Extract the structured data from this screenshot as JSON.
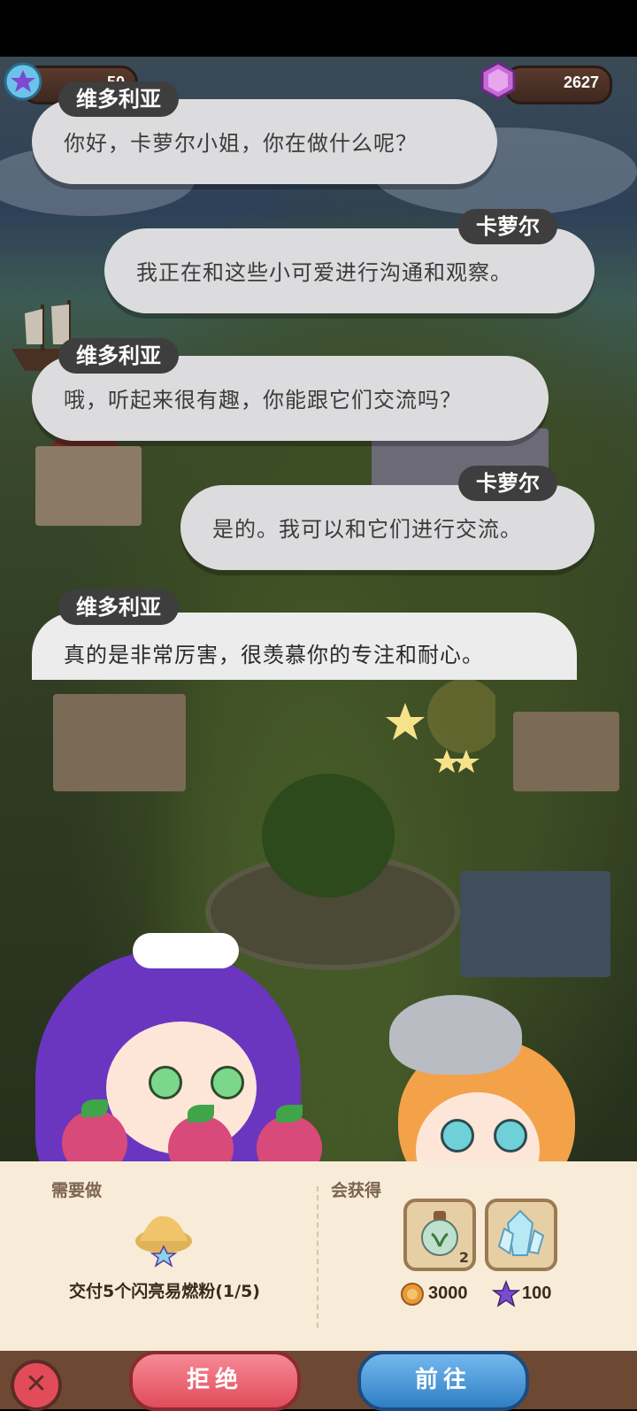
{
  "currency": {
    "stars": "50",
    "gems": "2627"
  },
  "dialogue": [
    {
      "speaker": "维多利亚",
      "text": "你好，卡萝尔小姐，你在做什么呢？"
    },
    {
      "speaker": "卡萝尔",
      "text": "我正在和这些小可爱进行沟通和观察。"
    },
    {
      "speaker": "维多利亚",
      "text": "哦，听起来很有趣，你能跟它们交流吗？"
    },
    {
      "speaker": "卡萝尔",
      "text": "是的。我可以和它们进行交流。"
    },
    {
      "speaker": "维多利亚",
      "text": "真的是非常厉害，很羡慕你的专注和耐心。"
    }
  ],
  "quest": {
    "need_label": "需要做",
    "task_text": "交付5个闪亮易燃粉(1/5)",
    "reward_label": "会获得",
    "reward_item_count": "2",
    "coins": "3000",
    "stars": "100"
  },
  "buttons": {
    "reject": "拒绝",
    "go": "前往",
    "close": "✕"
  },
  "colors": {
    "reject_button": "#e65a6a",
    "go_button": "#3a86c8",
    "panel": "#f8ecd8",
    "bubble": "#dcdcde",
    "nametag": "#3e3e3e"
  },
  "icons": [
    "star-currency-icon",
    "gem-icon",
    "powder-icon",
    "seed-bottle-icon",
    "crystal-icon",
    "coin-icon",
    "star-icon",
    "close-icon"
  ]
}
